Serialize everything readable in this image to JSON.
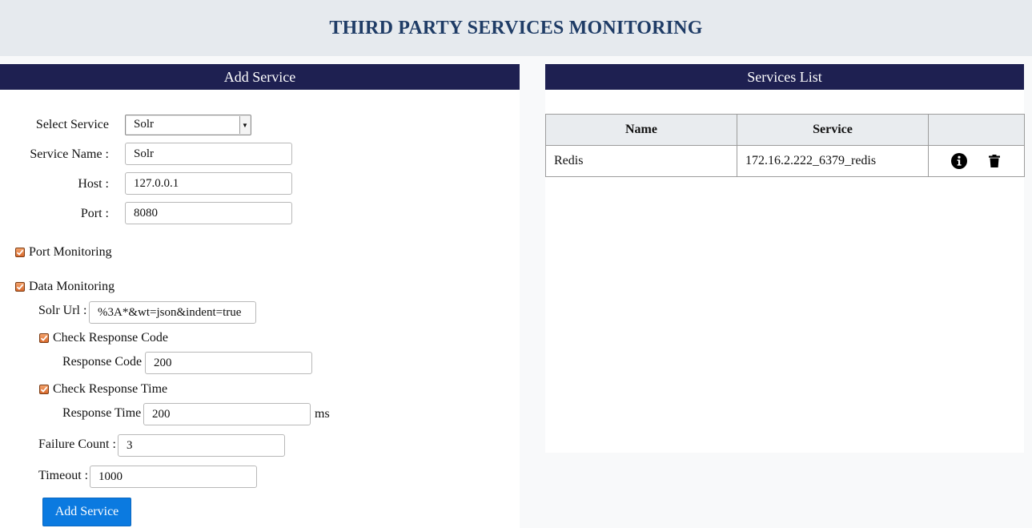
{
  "header": {
    "title": "THIRD PARTY SERVICES MONITORING"
  },
  "add_service": {
    "panel_title": "Add Service",
    "select_service_label": "Select Service",
    "select_service_value": "Solr",
    "service_name_label": "Service Name :",
    "service_name_value": "Solr",
    "host_label": "Host :",
    "host_value": "127.0.0.1",
    "port_label": "Port :",
    "port_value": "8080",
    "port_monitoring_label": "Port Monitoring",
    "data_monitoring_label": "Data Monitoring",
    "solr_url_label": "Solr Url :",
    "solr_url_value": "%3A*&wt=json&indent=true",
    "check_response_code_label": "Check Response Code",
    "response_code_label": "Response Code",
    "response_code_value": "200",
    "check_response_time_label": "Check Response Time",
    "response_time_label": "Response Time",
    "response_time_value": "200",
    "response_time_unit": "ms",
    "failure_count_label": "Failure Count :",
    "failure_count_value": "3",
    "timeout_label": "Timeout :",
    "timeout_value": "1000",
    "submit_label": "Add Service"
  },
  "services_list": {
    "panel_title": "Services List",
    "columns": [
      "Name",
      "Service",
      ""
    ],
    "rows": [
      {
        "name": "Redis",
        "service": "172.16.2.222_6379_redis"
      }
    ]
  },
  "icons": {
    "checkbox": "check-icon",
    "info": "info-icon",
    "delete": "trash-icon",
    "dropdown": "chevron-down-icon"
  },
  "colors": {
    "header_text": "#1f3c66",
    "panel_bar": "#1e2051",
    "button": "#0b7ae0",
    "checkbox": "#d8692c"
  }
}
